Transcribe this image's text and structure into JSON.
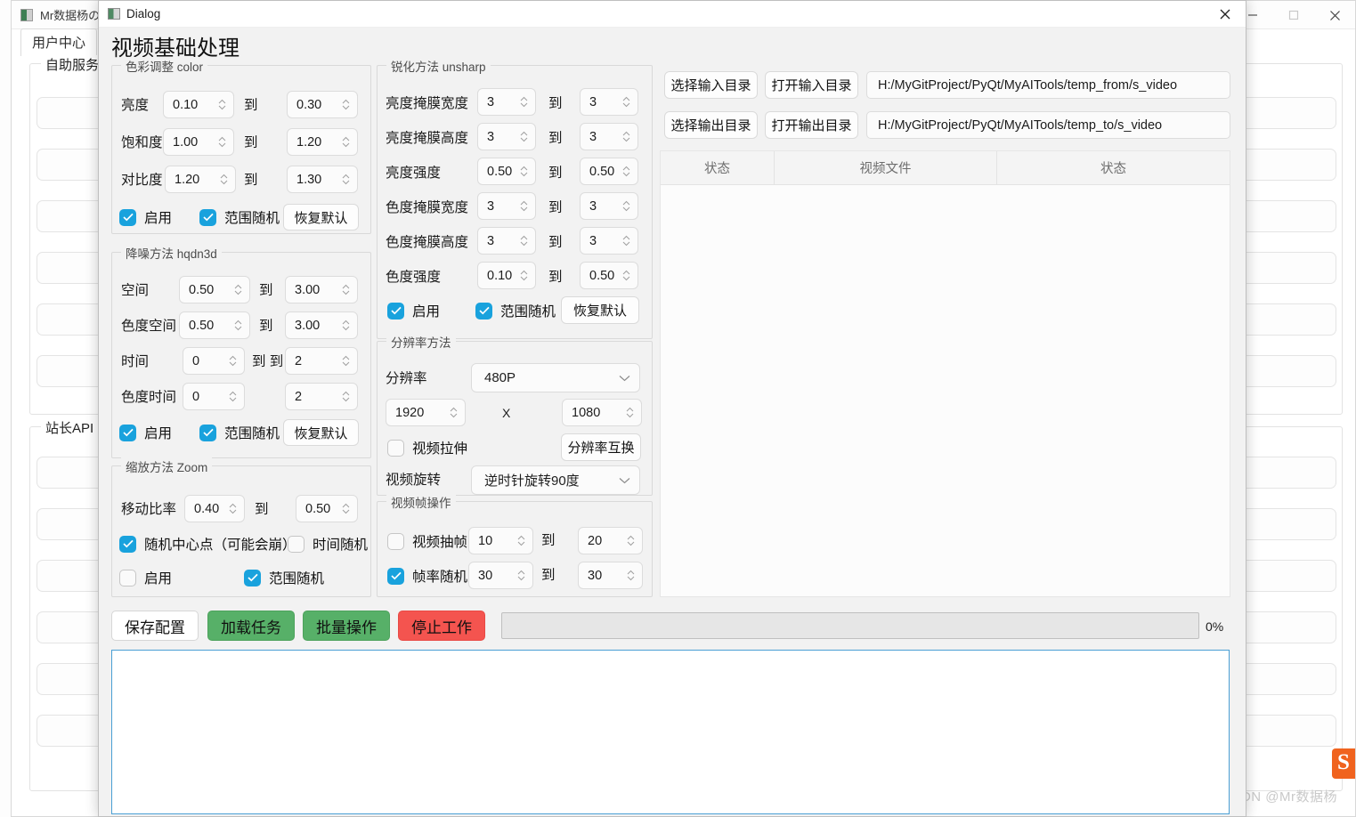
{
  "background_window": {
    "title": "Mr数据杨のAI工",
    "icon": "app-icon",
    "tab": "用户中心",
    "groups": [
      {
        "label": "自助服务"
      },
      {
        "label": "站长API SK"
      }
    ],
    "controls": {
      "minimize": "minimize-icon",
      "maximize": "maximize-icon",
      "close": "close-icon"
    },
    "watermark": "CSDN @Mr数据杨",
    "logo": "S"
  },
  "dialog": {
    "titlebar": {
      "title": "Dialog",
      "icon": "dialog-icon",
      "close": "close-icon"
    },
    "heading": "视频基础处理",
    "color_group": {
      "label": "色彩调整 color",
      "rows": [
        {
          "label": "亮度",
          "from": "0.10",
          "sep": "到",
          "to": "0.30"
        },
        {
          "label": "饱和度",
          "from": "1.00",
          "sep": "到",
          "to": "1.20"
        },
        {
          "label": "对比度",
          "from": "1.20",
          "sep": "到",
          "to": "1.30"
        }
      ],
      "enable": {
        "label": "启用",
        "checked": true
      },
      "random": {
        "label": "范围随机",
        "checked": true
      },
      "reset": "恢复默认"
    },
    "denoise_group": {
      "label": "降噪方法 hqdn3d",
      "rows": [
        {
          "label": "空间",
          "from": "0.50",
          "sep": "到",
          "to": "3.00"
        },
        {
          "label": "色度空间",
          "from": "0.50",
          "sep": "到",
          "to": "3.00"
        },
        {
          "label": "时间",
          "from": "0",
          "sep": "到  到",
          "to": "2"
        },
        {
          "label": "色度时间",
          "from": "0",
          "sep": "",
          "to": "2"
        }
      ],
      "enable": {
        "label": "启用",
        "checked": true
      },
      "random": {
        "label": "范围随机",
        "checked": true
      },
      "reset": "恢复默认"
    },
    "zoom_group": {
      "label": "缩放方法 Zoom",
      "rows": [
        {
          "label": "移动比率",
          "from": "0.40",
          "sep": "到",
          "to": "0.50"
        }
      ],
      "random_center": {
        "label": "随机中心点（可能会崩）",
        "checked": true
      },
      "time_random": {
        "label": "时间随机",
        "checked": false
      },
      "enable": {
        "label": "启用",
        "checked": false
      },
      "range_random": {
        "label": "范围随机",
        "checked": true
      }
    },
    "unsharp_group": {
      "label": "锐化方法 unsharp",
      "rows": [
        {
          "label": "亮度掩膜宽度",
          "from": "3",
          "sep": "到",
          "to": "3"
        },
        {
          "label": "亮度掩膜高度",
          "from": "3",
          "sep": "到",
          "to": "3"
        },
        {
          "label": "亮度强度",
          "from": "0.50",
          "sep": "到",
          "to": "0.50"
        },
        {
          "label": "色度掩膜宽度",
          "from": "3",
          "sep": "到",
          "to": "3"
        },
        {
          "label": "色度掩膜高度",
          "from": "3",
          "sep": "到",
          "to": "3"
        },
        {
          "label": "色度强度",
          "from": "0.10",
          "sep": "到",
          "to": "0.50"
        }
      ],
      "enable": {
        "label": "启用",
        "checked": true
      },
      "random": {
        "label": "范围随机",
        "checked": true
      },
      "reset": "恢复默认"
    },
    "resolution_group": {
      "label": "分辨率方法",
      "resolution_label": "分辨率",
      "resolution_value": "480P",
      "width": "1920",
      "x_label": "X",
      "height": "1080",
      "stretch": {
        "label": "视频拉伸",
        "checked": false
      },
      "swap_button": "分辨率互换",
      "rotate_label": "视频旋转",
      "rotate_value": "逆时针旋转90度"
    },
    "frame_group": {
      "label": "视频帧操作",
      "rows": [
        {
          "label": "视频抽帧",
          "checked": false,
          "from": "10",
          "sep": "到",
          "to": "20"
        },
        {
          "label": "帧率随机",
          "checked": true,
          "from": "30",
          "sep": "到",
          "to": "30"
        }
      ]
    },
    "io_panel": {
      "select_input": "选择输入目录",
      "open_input": "打开输入目录",
      "input_path": "H:/MyGitProject/PyQt/MyAITools/temp_from/s_video",
      "select_output": "选择输出目录",
      "open_output": "打开输出目录",
      "output_path": "H:/MyGitProject/PyQt/MyAITools/temp_to/s_video",
      "table_headers": [
        "状态",
        "视频文件",
        "状态"
      ]
    },
    "actions": {
      "save_config": "保存配置",
      "load_task": "加载任务",
      "batch_op": "批量操作",
      "stop_work": "停止工作",
      "progress_pct": "0%",
      "progress_value": 0
    },
    "log_area": {
      "text": ""
    }
  },
  "colors": {
    "checkbox_on": "#19a2dd",
    "button_green": "#57b068",
    "button_red": "#f4544f",
    "log_border": "#4a9fd4",
    "logo_orange": "#f0631e"
  }
}
